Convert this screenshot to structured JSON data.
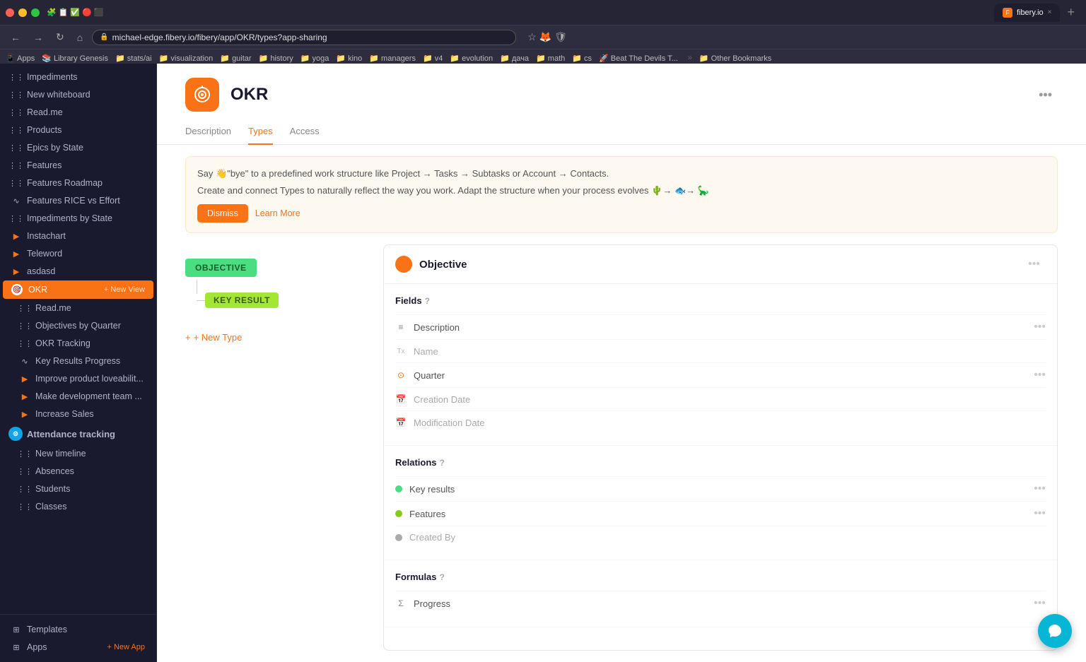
{
  "browser": {
    "address": "michael-edge.fibery.io/fibery/app/OKR/types?app-sharing",
    "tab_label": "fibery.io",
    "nav_back": "←",
    "nav_forward": "→",
    "nav_refresh": "↻"
  },
  "bookmarks": [
    "Apps",
    "Library Genesis",
    "stats/ai",
    "visualization",
    "guitar",
    "history",
    "yoga",
    "kino",
    "managers",
    "v4",
    "evolution",
    "дача",
    "math",
    "cs",
    "Beat The Devils T...",
    "Other Bookmarks"
  ],
  "page": {
    "app_name": "OKR",
    "tabs": [
      {
        "label": "Description",
        "active": false
      },
      {
        "label": "Types",
        "active": true
      },
      {
        "label": "Access",
        "active": false
      }
    ]
  },
  "banner": {
    "line1": "Say 👋\"bye\" to a predefined work structure like Project → Tasks → Subtasks or Account → Contacts.",
    "line2": "Create and connect Types to naturally reflect the way you work. Adapt the structure when your process evolves 🌵→ 🐟→ 🦕",
    "dismiss_label": "Dismiss",
    "learn_label": "Learn More"
  },
  "diagram": {
    "objective_label": "OBJECTIVE",
    "kr_label": "KEY RESULT",
    "new_type_label": "+ New Type"
  },
  "detail": {
    "title": "Objective",
    "fields_section": "Fields",
    "fields_help": "?",
    "fields": [
      {
        "icon": "≡",
        "name": "Description",
        "muted": false,
        "has_dots": true
      },
      {
        "icon": "Tx",
        "name": "Name",
        "muted": true,
        "has_dots": false
      },
      {
        "icon": "⊙",
        "name": "Quarter",
        "muted": false,
        "has_dots": true
      },
      {
        "icon": "☐",
        "name": "Creation Date",
        "muted": true,
        "has_dots": false
      },
      {
        "icon": "☐",
        "name": "Modification Date",
        "muted": true,
        "has_dots": false
      }
    ],
    "relations_section": "Relations",
    "relations_help": "?",
    "relations": [
      {
        "color": "green",
        "name": "Key results",
        "has_dots": true
      },
      {
        "color": "olive",
        "name": "Features",
        "has_dots": true
      },
      {
        "color": "gray",
        "name": "Created By",
        "has_dots": false
      }
    ],
    "formulas_section": "Formulas",
    "formulas_help": "?",
    "formulas": [
      {
        "icon": "Σ",
        "name": "Progress",
        "has_dots": true
      }
    ]
  },
  "sidebar": {
    "items": [
      {
        "label": "Impediments",
        "icon": "grid",
        "level": 1
      },
      {
        "label": "New whiteboard",
        "icon": "grid",
        "level": 1
      },
      {
        "label": "Read.me",
        "icon": "grid",
        "level": 1
      },
      {
        "label": "Products",
        "icon": "grid",
        "level": 1
      },
      {
        "label": "Epics by State",
        "icon": "grid",
        "level": 1
      },
      {
        "label": "Features",
        "icon": "grid",
        "level": 1
      },
      {
        "label": "Features Roadmap",
        "icon": "grid",
        "level": 1
      },
      {
        "label": "Features RICE vs Effort",
        "icon": "tilde",
        "level": 1
      },
      {
        "label": "Impediments by State",
        "icon": "grid",
        "level": 1
      },
      {
        "label": "Instachart",
        "icon": "play",
        "level": 1
      },
      {
        "label": "Teleword",
        "icon": "play",
        "level": 1
      },
      {
        "label": "asdasd",
        "icon": "play",
        "level": 1
      },
      {
        "label": "OKR",
        "icon": "target",
        "level": 0,
        "active": true,
        "new_view": "+ New View"
      },
      {
        "label": "Read.me",
        "icon": "grid",
        "level": 1
      },
      {
        "label": "Objectives by Quarter",
        "icon": "grid",
        "level": 1
      },
      {
        "label": "OKR Tracking",
        "icon": "grid",
        "level": 1
      },
      {
        "label": "Key Results Progress",
        "icon": "tilde",
        "level": 1
      },
      {
        "label": "Improve product loveabilit...",
        "icon": "play",
        "level": 1
      },
      {
        "label": "Make development team ...",
        "icon": "play",
        "level": 1
      },
      {
        "label": "Increase Sales",
        "icon": "play",
        "level": 1
      },
      {
        "label": "Attendance tracking",
        "icon": "circle",
        "level": 0
      },
      {
        "label": "New timeline",
        "icon": "grid",
        "level": 1
      },
      {
        "label": "Absences",
        "icon": "grid",
        "level": 1
      },
      {
        "label": "Students",
        "icon": "grid",
        "level": 1
      },
      {
        "label": "Classes",
        "icon": "grid",
        "level": 1
      }
    ],
    "bottom": [
      {
        "label": "Templates",
        "icon": "grid"
      },
      {
        "label": "Apps",
        "icon": "grid"
      }
    ],
    "new_app_label": "+ New App"
  }
}
